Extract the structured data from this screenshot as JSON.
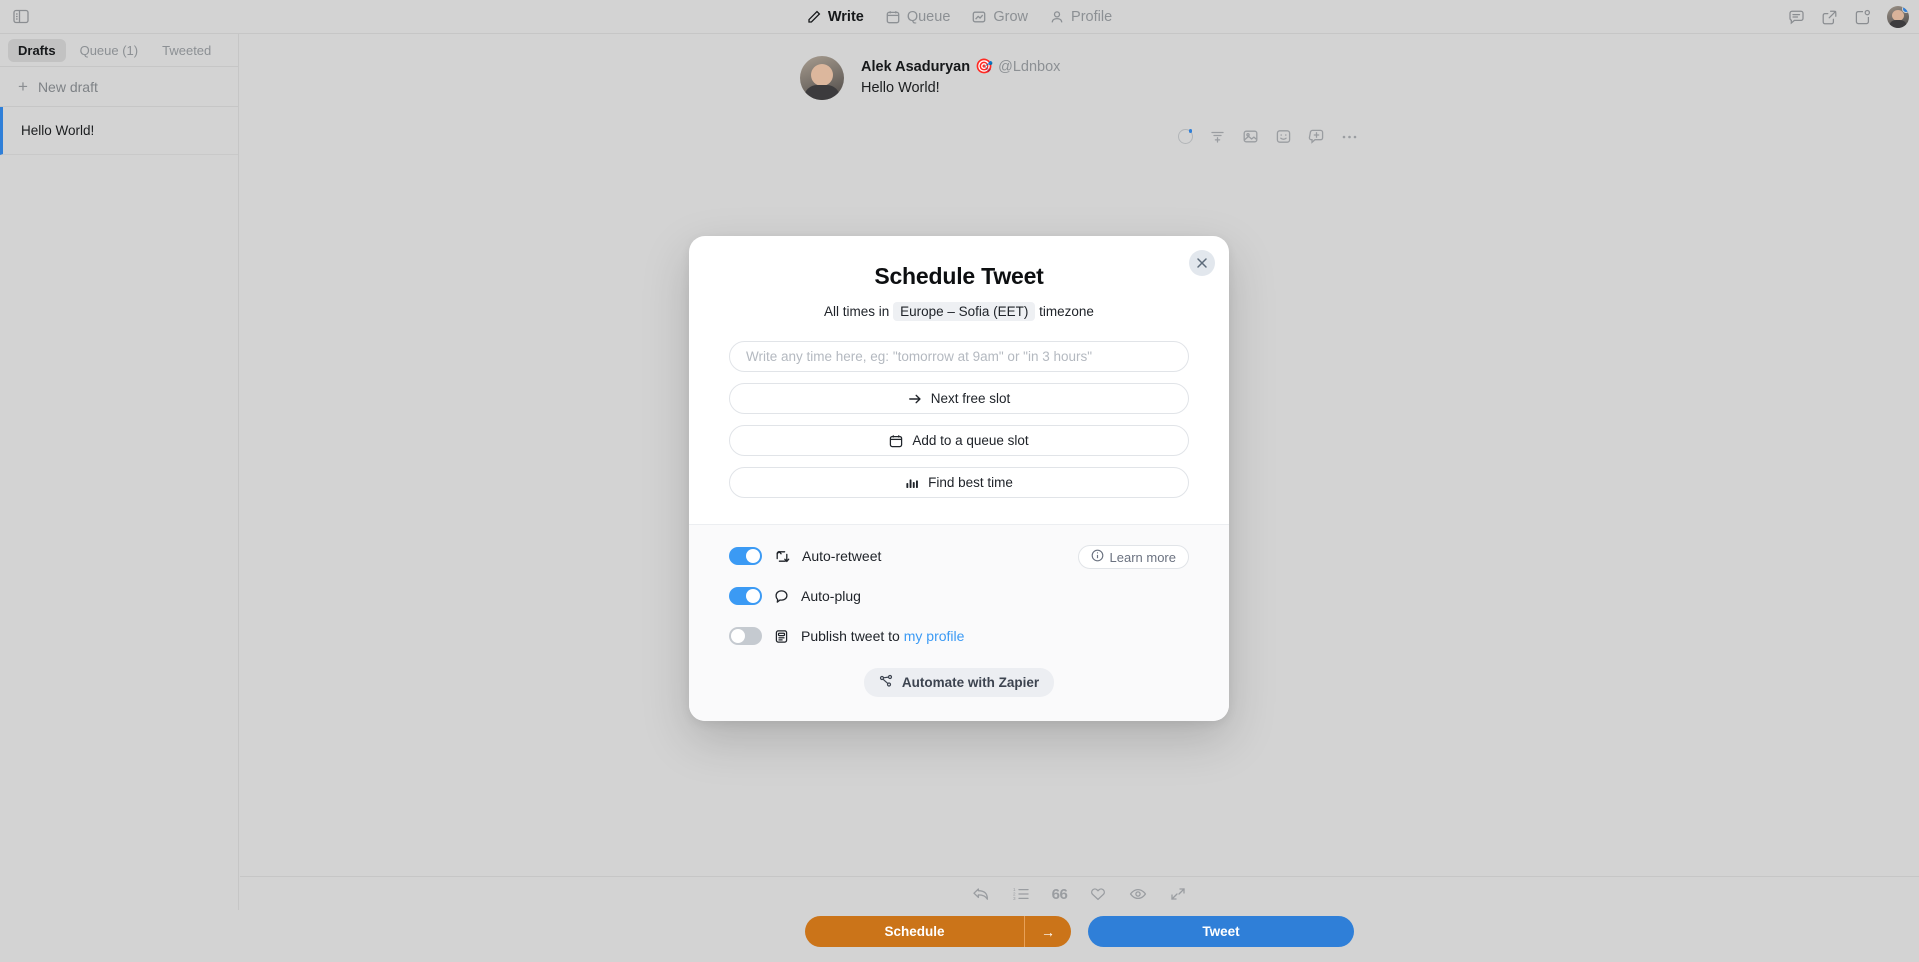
{
  "topbar": {
    "sidebar_toggle_icon": "sidebar-panel-icon",
    "nav": [
      {
        "label": "Write",
        "icon": "pencil-icon",
        "active": true
      },
      {
        "label": "Queue",
        "icon": "calendar-icon",
        "active": false
      },
      {
        "label": "Grow",
        "icon": "chart-up-icon",
        "active": false
      },
      {
        "label": "Profile",
        "icon": "person-icon",
        "active": false
      }
    ],
    "right_icons": [
      "comment-icon",
      "external-link-icon",
      "notification-clock-icon"
    ],
    "avatar": "user-avatar"
  },
  "sidebar": {
    "tabs": [
      {
        "label": "Drafts",
        "active": true
      },
      {
        "label": "Queue (1)",
        "active": false
      },
      {
        "label": "Tweeted",
        "active": false
      }
    ],
    "new_draft_label": "New draft",
    "drafts": [
      {
        "title": "Hello World!"
      }
    ]
  },
  "compose": {
    "author_name": "Alek Asaduryan",
    "author_emoji": "🎯",
    "author_handle": "@Ldnbox",
    "tweet_text": "Hello World!",
    "tools": [
      "char-count-ring-icon",
      "thread-add-icon",
      "image-icon",
      "emoji-icon",
      "add-tweet-icon",
      "more-options-icon"
    ]
  },
  "modal": {
    "title": "Schedule Tweet",
    "subtitle_prefix": "All times in",
    "timezone": "Europe – Sofia (EET)",
    "subtitle_suffix": "timezone",
    "close_icon": "close-icon",
    "time_input_placeholder": "Write any time here, eg: \"tomorrow at 9am\" or \"in 3 hours\"",
    "time_input_value": "",
    "options": [
      {
        "label": "Next free slot",
        "icon": "arrow-right-icon"
      },
      {
        "label": "Add to a queue slot",
        "icon": "calendar-icon"
      },
      {
        "label": "Find best time",
        "icon": "bar-chart-icon"
      }
    ],
    "toggles": [
      {
        "label": "Auto-retweet",
        "icon": "retweet-icon",
        "on": true
      },
      {
        "label": "Auto-plug",
        "icon": "speech-bubble-icon",
        "on": true
      },
      {
        "label": "Publish tweet to",
        "link_label": "my profile",
        "icon": "profile-card-icon",
        "on": false
      }
    ],
    "learn_more_label": "Learn more",
    "learn_more_icon": "info-icon",
    "zapier_label": "Automate with Zapier",
    "zapier_icon": "zapier-nodes-icon"
  },
  "bottombar": {
    "tools": [
      "reply-arrow-icon",
      "numbered-list-icon",
      "quote-icon",
      "heart-icon",
      "eye-icon",
      "expand-icon"
    ],
    "quote_glyph": "66",
    "schedule_label": "Schedule",
    "schedule_arrow": "→",
    "tweet_label": "Tweet"
  },
  "colors": {
    "accent_blue": "#2f7fd8",
    "toggle_blue": "#3b9af4",
    "schedule_orange": "#cb7419",
    "page_background": "#d3d3d3",
    "modal_background": "#ffffff"
  }
}
